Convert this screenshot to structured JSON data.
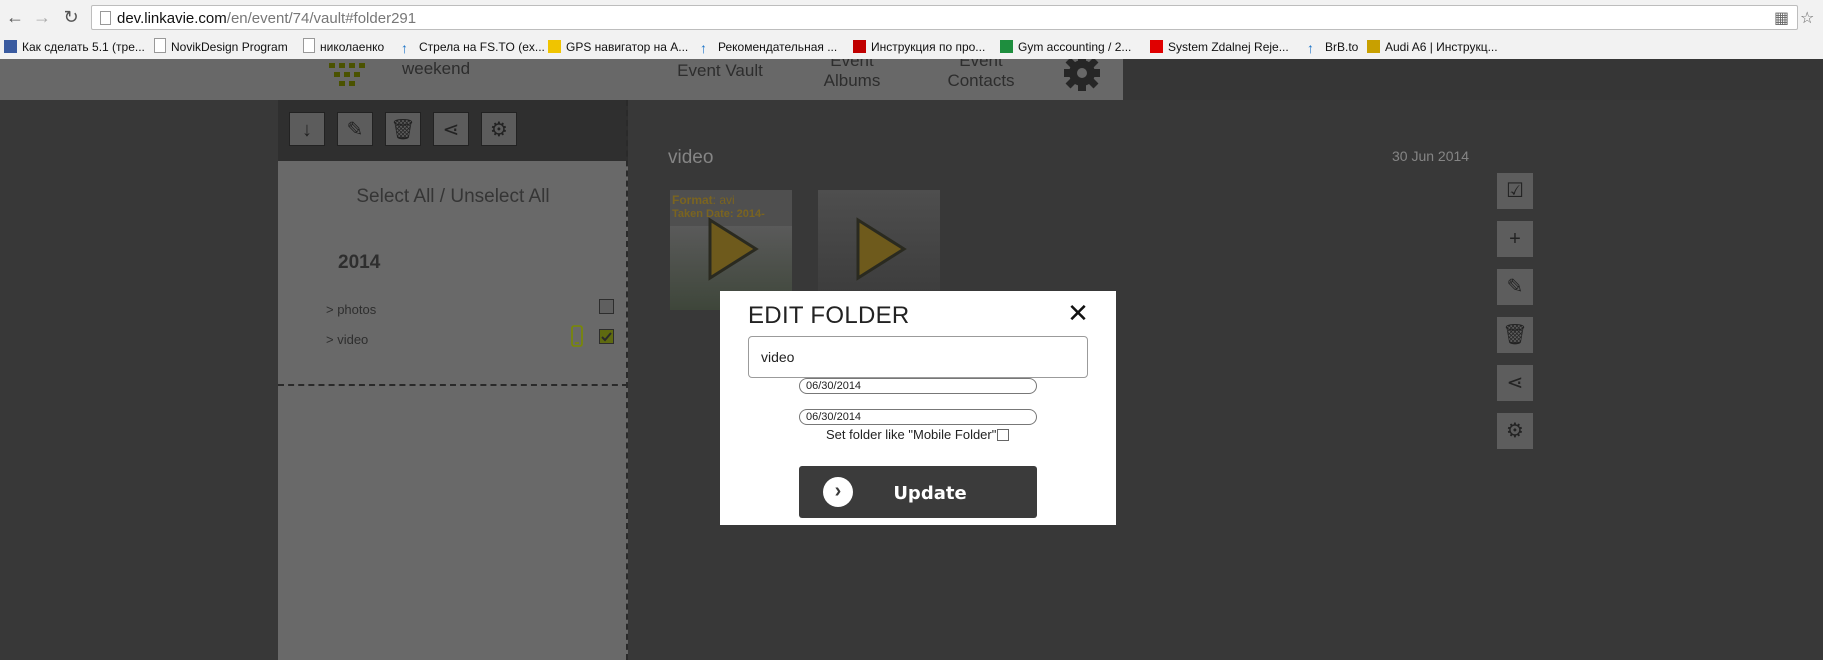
{
  "browser": {
    "url_host": "dev.linkavie.com",
    "url_path": "/en/event/74/vault#folder291",
    "bookmarks": [
      {
        "label": "Как сделать 5.1 (тре...",
        "icon": "b-logo-icon",
        "color": "#3a5ba0"
      },
      {
        "label": "NovikDesign Program",
        "icon": "page-icon",
        "color": "#ffffff"
      },
      {
        "label": "николаенко",
        "icon": "page-icon",
        "color": "#ffffff"
      },
      {
        "label": "Стрела на FS.TO (ex...",
        "icon": "arrow-up-icon",
        "color": "#1a73c8"
      },
      {
        "label": "GPS навигатор на A...",
        "icon": "gps-icon",
        "color": "#f0c400"
      },
      {
        "label": "Рекомендательная ...",
        "icon": "arrow-up-icon",
        "color": "#1a73c8"
      },
      {
        "label": "Инструкция по про...",
        "icon": "info-icon",
        "color": "#c00000"
      },
      {
        "label": "Gym accounting / 2...",
        "icon": "sheets-icon",
        "color": "#1e8e3e"
      },
      {
        "label": "System Zdalnej Reje...",
        "icon": "flag-icon",
        "color": "#e00000"
      },
      {
        "label": "BrB.to",
        "icon": "arrow-up-icon",
        "color": "#1a73c8"
      },
      {
        "label": "Audi A6 | Инструкц...",
        "icon": "car-icon",
        "color": "#c8a000"
      }
    ]
  },
  "header": {
    "logo_text": "weekend",
    "nav": [
      {
        "label_top": "",
        "label": "Event Vault"
      },
      {
        "label_top": "Event",
        "label": "Albums"
      },
      {
        "label_top": "Event",
        "label": "Contacts"
      }
    ]
  },
  "left_panel": {
    "toolbar": [
      "download-icon",
      "edit-icon",
      "trash-icon",
      "share-icon",
      "settings-icon"
    ],
    "select_all": "Select All / Unselect All",
    "year": "2014",
    "folders": [
      {
        "label": "> photos",
        "checked": false,
        "mobile": false
      },
      {
        "label": "> video",
        "checked": true,
        "mobile": true
      }
    ]
  },
  "main": {
    "folder_title": "video",
    "folder_date": "30 Jun 2014",
    "thumb_overlay_format_label": "Format",
    "thumb_overlay_format_value": ": avi",
    "thumb_overlay_date": "Taken Date: 2014-",
    "side_actions": [
      "select-check-icon",
      "add-icon",
      "edit-icon",
      "trash-icon",
      "share-icon",
      "settings-icon"
    ]
  },
  "modal": {
    "title": "EDIT FOLDER",
    "name_value": "video",
    "date_from": "06/30/2014",
    "date_to": "06/30/2014",
    "mobile_label": "Set folder like \"Mobile Folder\"",
    "update_label": "Update"
  },
  "colors": {
    "overlay_dark": "#383838",
    "accent_olive": "#8a9a00",
    "play_gold": "#6e5a1c"
  }
}
